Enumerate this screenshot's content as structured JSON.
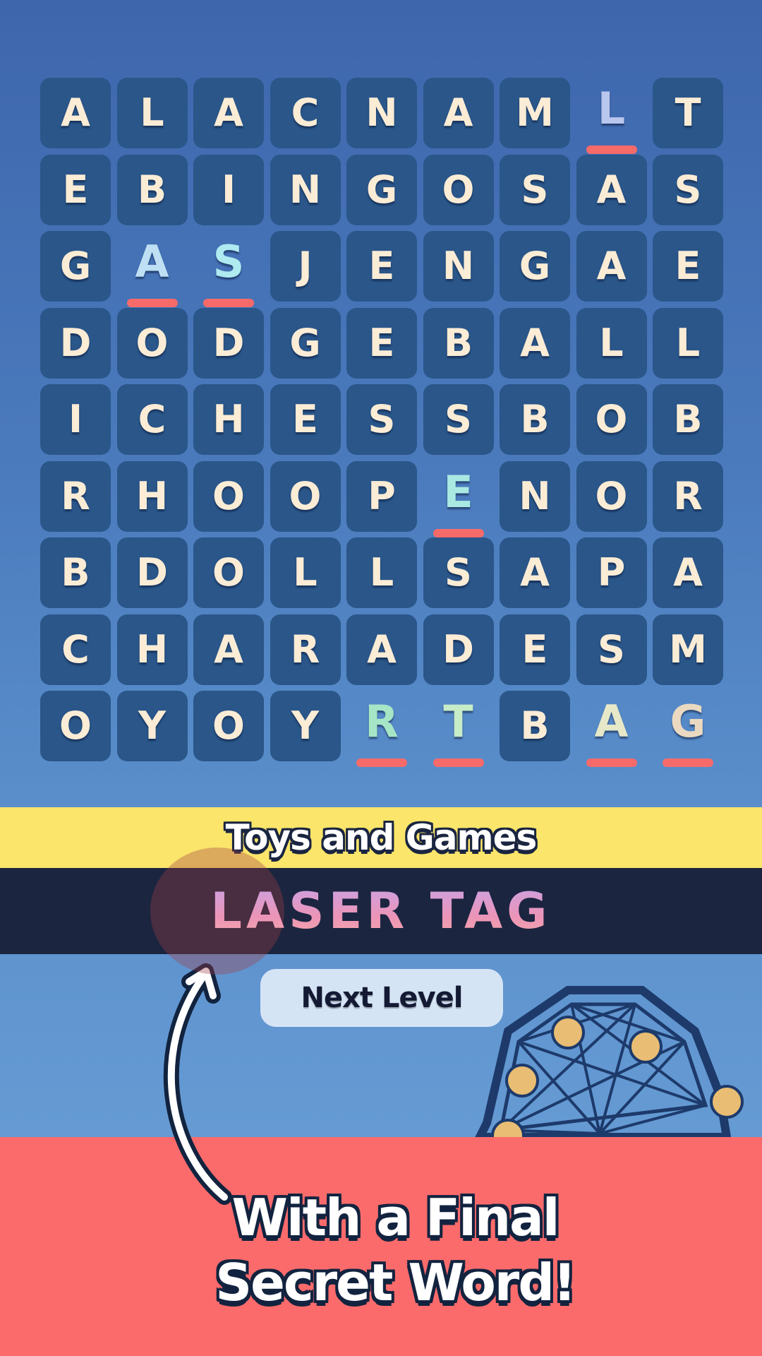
{
  "grid": {
    "rows": [
      [
        "A",
        "L",
        "A",
        "C",
        "N",
        "A",
        "M",
        "L",
        "T"
      ],
      [
        "E",
        "B",
        "I",
        "N",
        "G",
        "O",
        "S",
        "A",
        "S"
      ],
      [
        "G",
        "A",
        "S",
        "J",
        "E",
        "N",
        "G",
        "A",
        "E"
      ],
      [
        "D",
        "O",
        "D",
        "G",
        "E",
        "B",
        "A",
        "L",
        "L"
      ],
      [
        "I",
        "C",
        "H",
        "E",
        "S",
        "S",
        "B",
        "O",
        "B"
      ],
      [
        "R",
        "H",
        "O",
        "O",
        "P",
        "E",
        "N",
        "O",
        "R"
      ],
      [
        "B",
        "D",
        "O",
        "L",
        "L",
        "S",
        "A",
        "P",
        "A"
      ],
      [
        "C",
        "H",
        "A",
        "R",
        "A",
        "D",
        "E",
        "S",
        "M"
      ],
      [
        "O",
        "Y",
        "O",
        "Y",
        "R",
        "T",
        "B",
        "A",
        "G"
      ]
    ],
    "picked": [
      {
        "row": 0,
        "col": 7,
        "letter": "L",
        "color": "#b9c6ee"
      },
      {
        "row": 2,
        "col": 1,
        "letter": "A",
        "color": "#bfe0f4"
      },
      {
        "row": 2,
        "col": 2,
        "letter": "S",
        "color": "#aeeaf0"
      },
      {
        "row": 5,
        "col": 5,
        "letter": "E",
        "color": "#a9e9e2"
      },
      {
        "row": 8,
        "col": 4,
        "letter": "R",
        "color": "#a6e6c6"
      },
      {
        "row": 8,
        "col": 5,
        "letter": "T",
        "color": "#c6ecc8"
      },
      {
        "row": 8,
        "col": 7,
        "letter": "A",
        "color": "#e6e8c8"
      },
      {
        "row": 8,
        "col": 8,
        "letter": "G",
        "color": "#ead9c0"
      }
    ]
  },
  "category": "Toys and Games",
  "secret_word": "LASER TAG",
  "next_button": "Next Level",
  "promo": {
    "line1": "With a Final",
    "line2": "Secret Word!"
  },
  "colors": {
    "underline": "#f76a6a",
    "category_bar": "#fbe56a",
    "answer_bar": "#1b2540",
    "promo_bg": "#fb6b6b"
  }
}
